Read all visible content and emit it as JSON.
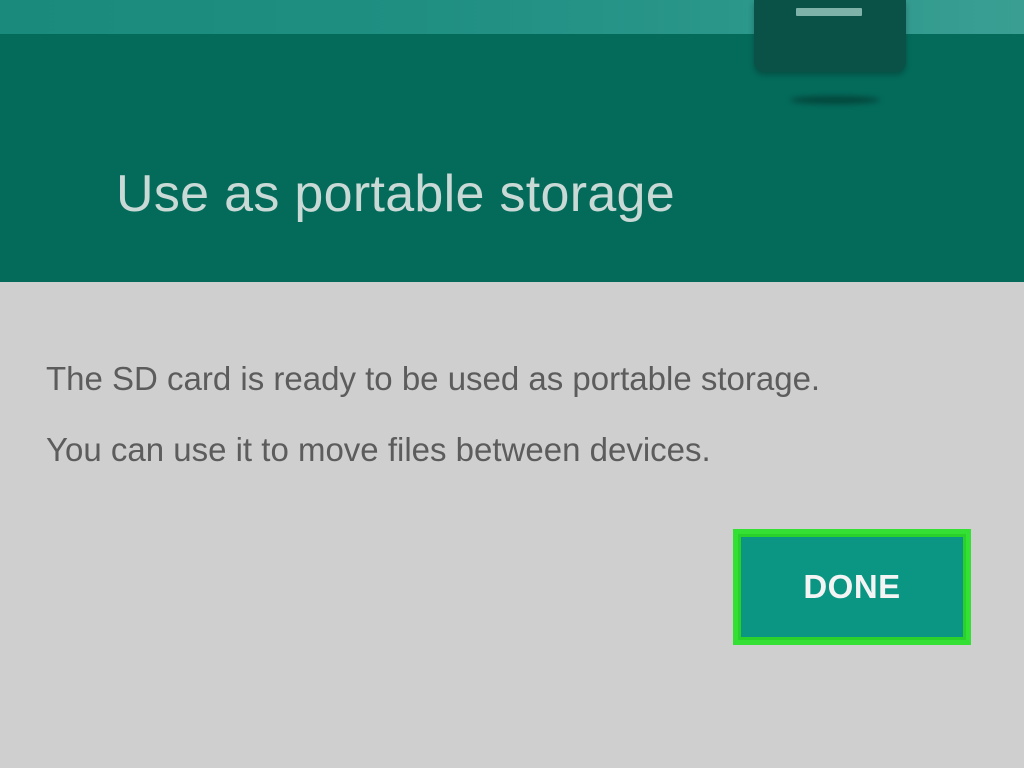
{
  "header": {
    "title": "Use as portable storage",
    "icon": "sd-card-icon",
    "background_color": "#046b5b"
  },
  "message": {
    "line1": "The SD card is ready to be used as portable storage.",
    "line2": "You can use it to move files between devices."
  },
  "actions": {
    "done_label": "DONE",
    "done_color": "#0b9684",
    "highlight_color": "#33e033"
  }
}
